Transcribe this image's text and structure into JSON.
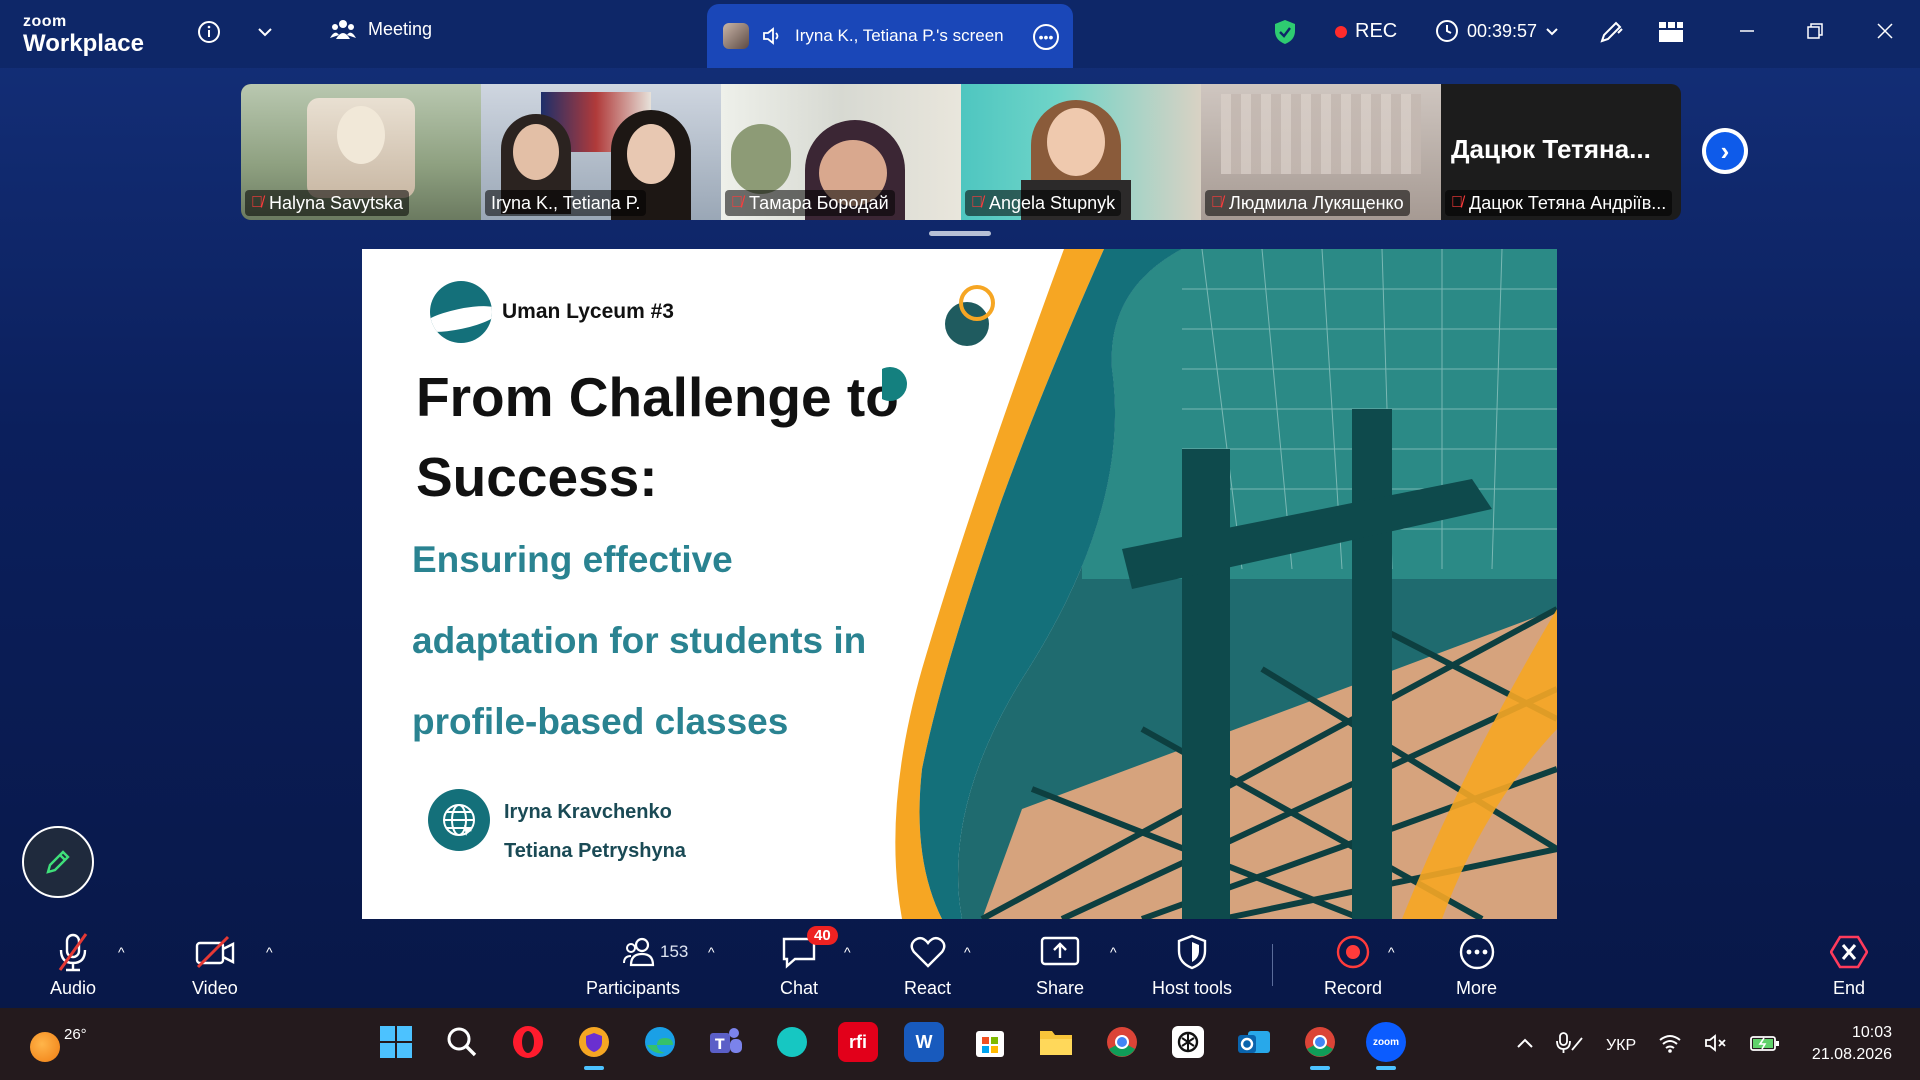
{
  "app": {
    "brand_top": "zoom",
    "brand_bottom": "Workplace"
  },
  "topbar": {
    "meeting_label": "Meeting",
    "share_tab_label": "Iryna K., Tetiana P.'s screen",
    "rec_label": "REC",
    "timer": "00:39:57",
    "colors": {
      "rec": "#ff2b2b",
      "shield": "#2ecc71",
      "share_tab": "#1a47b8"
    }
  },
  "participants": [
    {
      "name": "Halyna Savytska",
      "muted": true
    },
    {
      "name": "Iryna K., Tetiana P.",
      "muted": false,
      "active": true
    },
    {
      "name": "Тамара Бородай",
      "muted": true
    },
    {
      "name": "Angela Stupnyk",
      "muted": true
    },
    {
      "name": "Людмила Лукященко",
      "muted": true
    },
    {
      "name": "Дацюк Тетяна Андріїв...",
      "muted": true,
      "video_off_label": "Дацюк  Тетяна..."
    }
  ],
  "slide": {
    "org": "Uman Lyceum #3",
    "title": "From Challenge to Success:",
    "subtitle_lines": [
      "Ensuring effective",
      "adaptation for students in",
      "profile-based classes"
    ],
    "authors": [
      "Iryna Kravchenko",
      "Tetiana Petryshyna"
    ],
    "colors": {
      "teal": "#14707a",
      "subtitle": "#2a8391",
      "orange": "#f6a623"
    }
  },
  "toolbar": {
    "audio": "Audio",
    "video": "Video",
    "participants": "Participants",
    "participants_count": "153",
    "chat": "Chat",
    "chat_badge": "40",
    "react": "React",
    "share": "Share",
    "host_tools": "Host tools",
    "record": "Record",
    "more": "More",
    "end": "End"
  },
  "taskbar": {
    "temperature": "26°",
    "language": "УКР",
    "time": "10:03",
    "date": "21.08.2026",
    "apps": [
      "windows-start",
      "search",
      "opera",
      "vpn-shield",
      "edge",
      "teams",
      "copilot",
      "rfi",
      "word",
      "microsoft-store",
      "file-explorer",
      "chrome",
      "chatgpt",
      "outlook",
      "chrome-profile",
      "zoom"
    ],
    "zoom_label": "zoom",
    "rfi_label": "rfi",
    "word_label": "W"
  }
}
